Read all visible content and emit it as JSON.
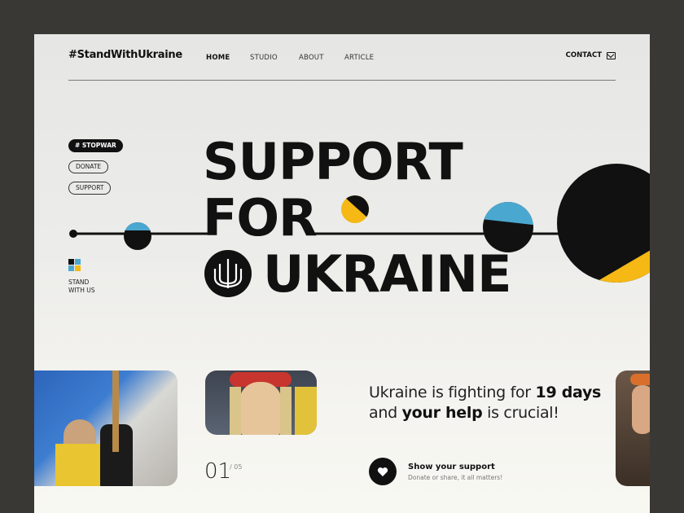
{
  "header": {
    "brand": "#StandWithUkraine",
    "nav": [
      "HOME",
      "STUDIO",
      "ABOUT",
      "ARTICLE"
    ],
    "contact": "CONTACT"
  },
  "tags": {
    "stopwar": "# STOPWAR",
    "donate": "DONATE",
    "support": "SUPPORT"
  },
  "stand": {
    "line1": "STAND",
    "line2": "WITH US"
  },
  "headline": {
    "line1": "SUPPORT",
    "line2": "FOR",
    "line3": "UKRAINE"
  },
  "message": {
    "part1": "Ukraine is fighting for ",
    "days": "19 days",
    "part2": "and ",
    "help": "your help",
    "part3": " is crucial!"
  },
  "slider": {
    "current": "01",
    "total": "/ 05"
  },
  "cta": {
    "title": "Show your support",
    "subtitle": "Donate or share, it all matters!"
  },
  "colors": {
    "blue": "#4aa8d0",
    "yellow": "#f5b814",
    "black": "#111111"
  }
}
